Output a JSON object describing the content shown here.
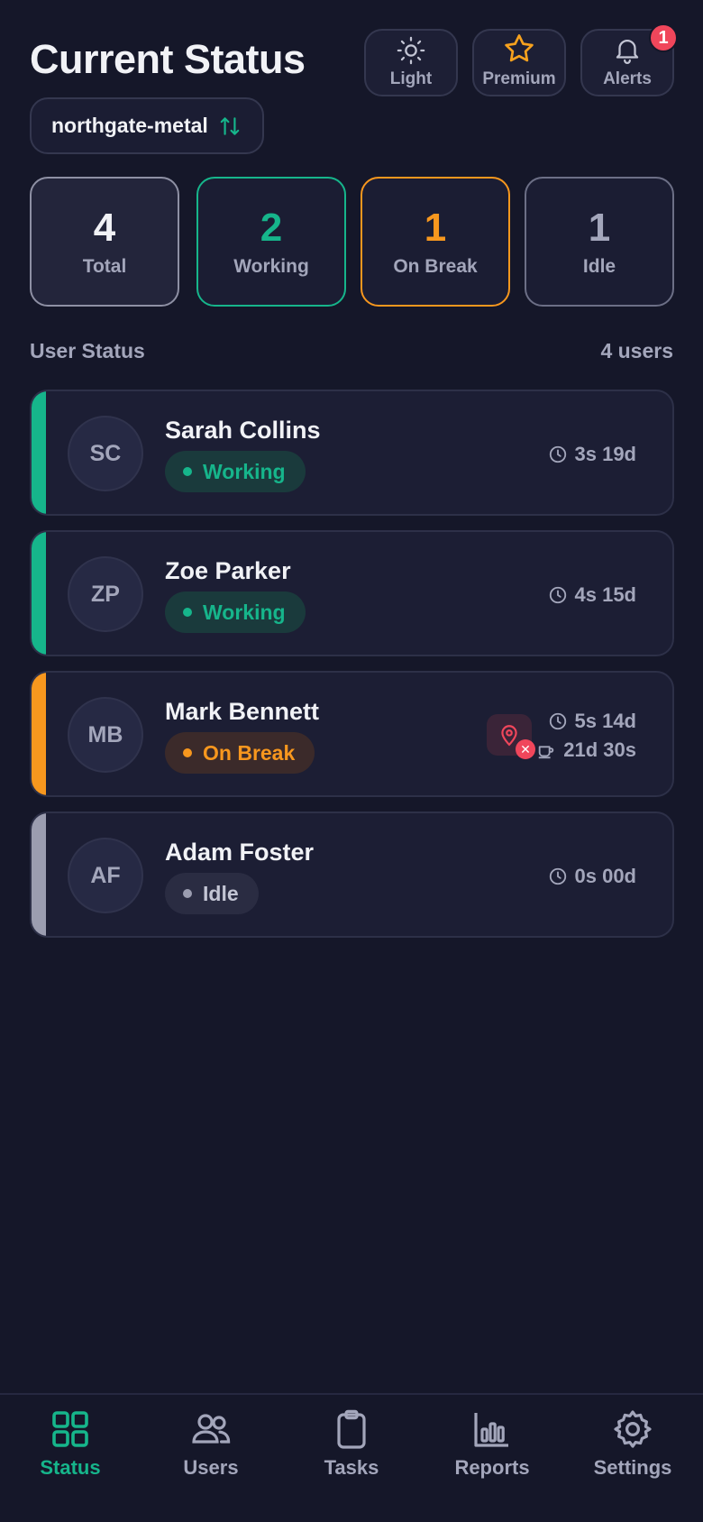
{
  "header": {
    "title": "Current Status",
    "buttons": [
      {
        "label": "Light",
        "icon": "sun-icon"
      },
      {
        "label": "Premium",
        "icon": "star-icon"
      },
      {
        "label": "Alerts",
        "icon": "bell-icon",
        "badge": "1"
      }
    ]
  },
  "org": {
    "name": "northgate-metal",
    "icon": "swap-vertical-icon"
  },
  "stats": [
    {
      "value": "4",
      "label": "Total",
      "color": "#f1f2f6"
    },
    {
      "value": "2",
      "label": "Working",
      "color": "#16b58b"
    },
    {
      "value": "1",
      "label": "On Break",
      "color": "#f7971e"
    },
    {
      "value": "1",
      "label": "Idle",
      "color": "#a3a6bb"
    }
  ],
  "section": {
    "title": "User Status",
    "count": "4 users"
  },
  "users": [
    {
      "initials": "SC",
      "name": "Sarah Collins",
      "status": "Working",
      "time": "3s 19d",
      "status_color": "#16b58b"
    },
    {
      "initials": "ZP",
      "name": "Zoe Parker",
      "status": "Working",
      "time": "4s 15d",
      "status_color": "#16b58b"
    },
    {
      "initials": "MB",
      "name": "Mark Bennett",
      "status": "On Break",
      "time": "5s 14d",
      "break_time": "21d 30s",
      "status_color": "#f7971e",
      "location_icon": "location-off-icon"
    },
    {
      "initials": "AF",
      "name": "Adam Foster",
      "status": "Idle",
      "time": "0s 00d",
      "status_color": "#a3a6bb"
    }
  ],
  "tabs": [
    {
      "label": "Status",
      "icon": "grid-icon",
      "active": true
    },
    {
      "label": "Users",
      "icon": "users-icon"
    },
    {
      "label": "Tasks",
      "icon": "clipboard-icon"
    },
    {
      "label": "Reports",
      "icon": "bar-chart-icon"
    },
    {
      "label": "Settings",
      "icon": "gear-icon"
    }
  ],
  "colors": {
    "accent": "#16b58b",
    "warning": "#f7971e",
    "danger": "#f0465b",
    "background": "#151729"
  }
}
